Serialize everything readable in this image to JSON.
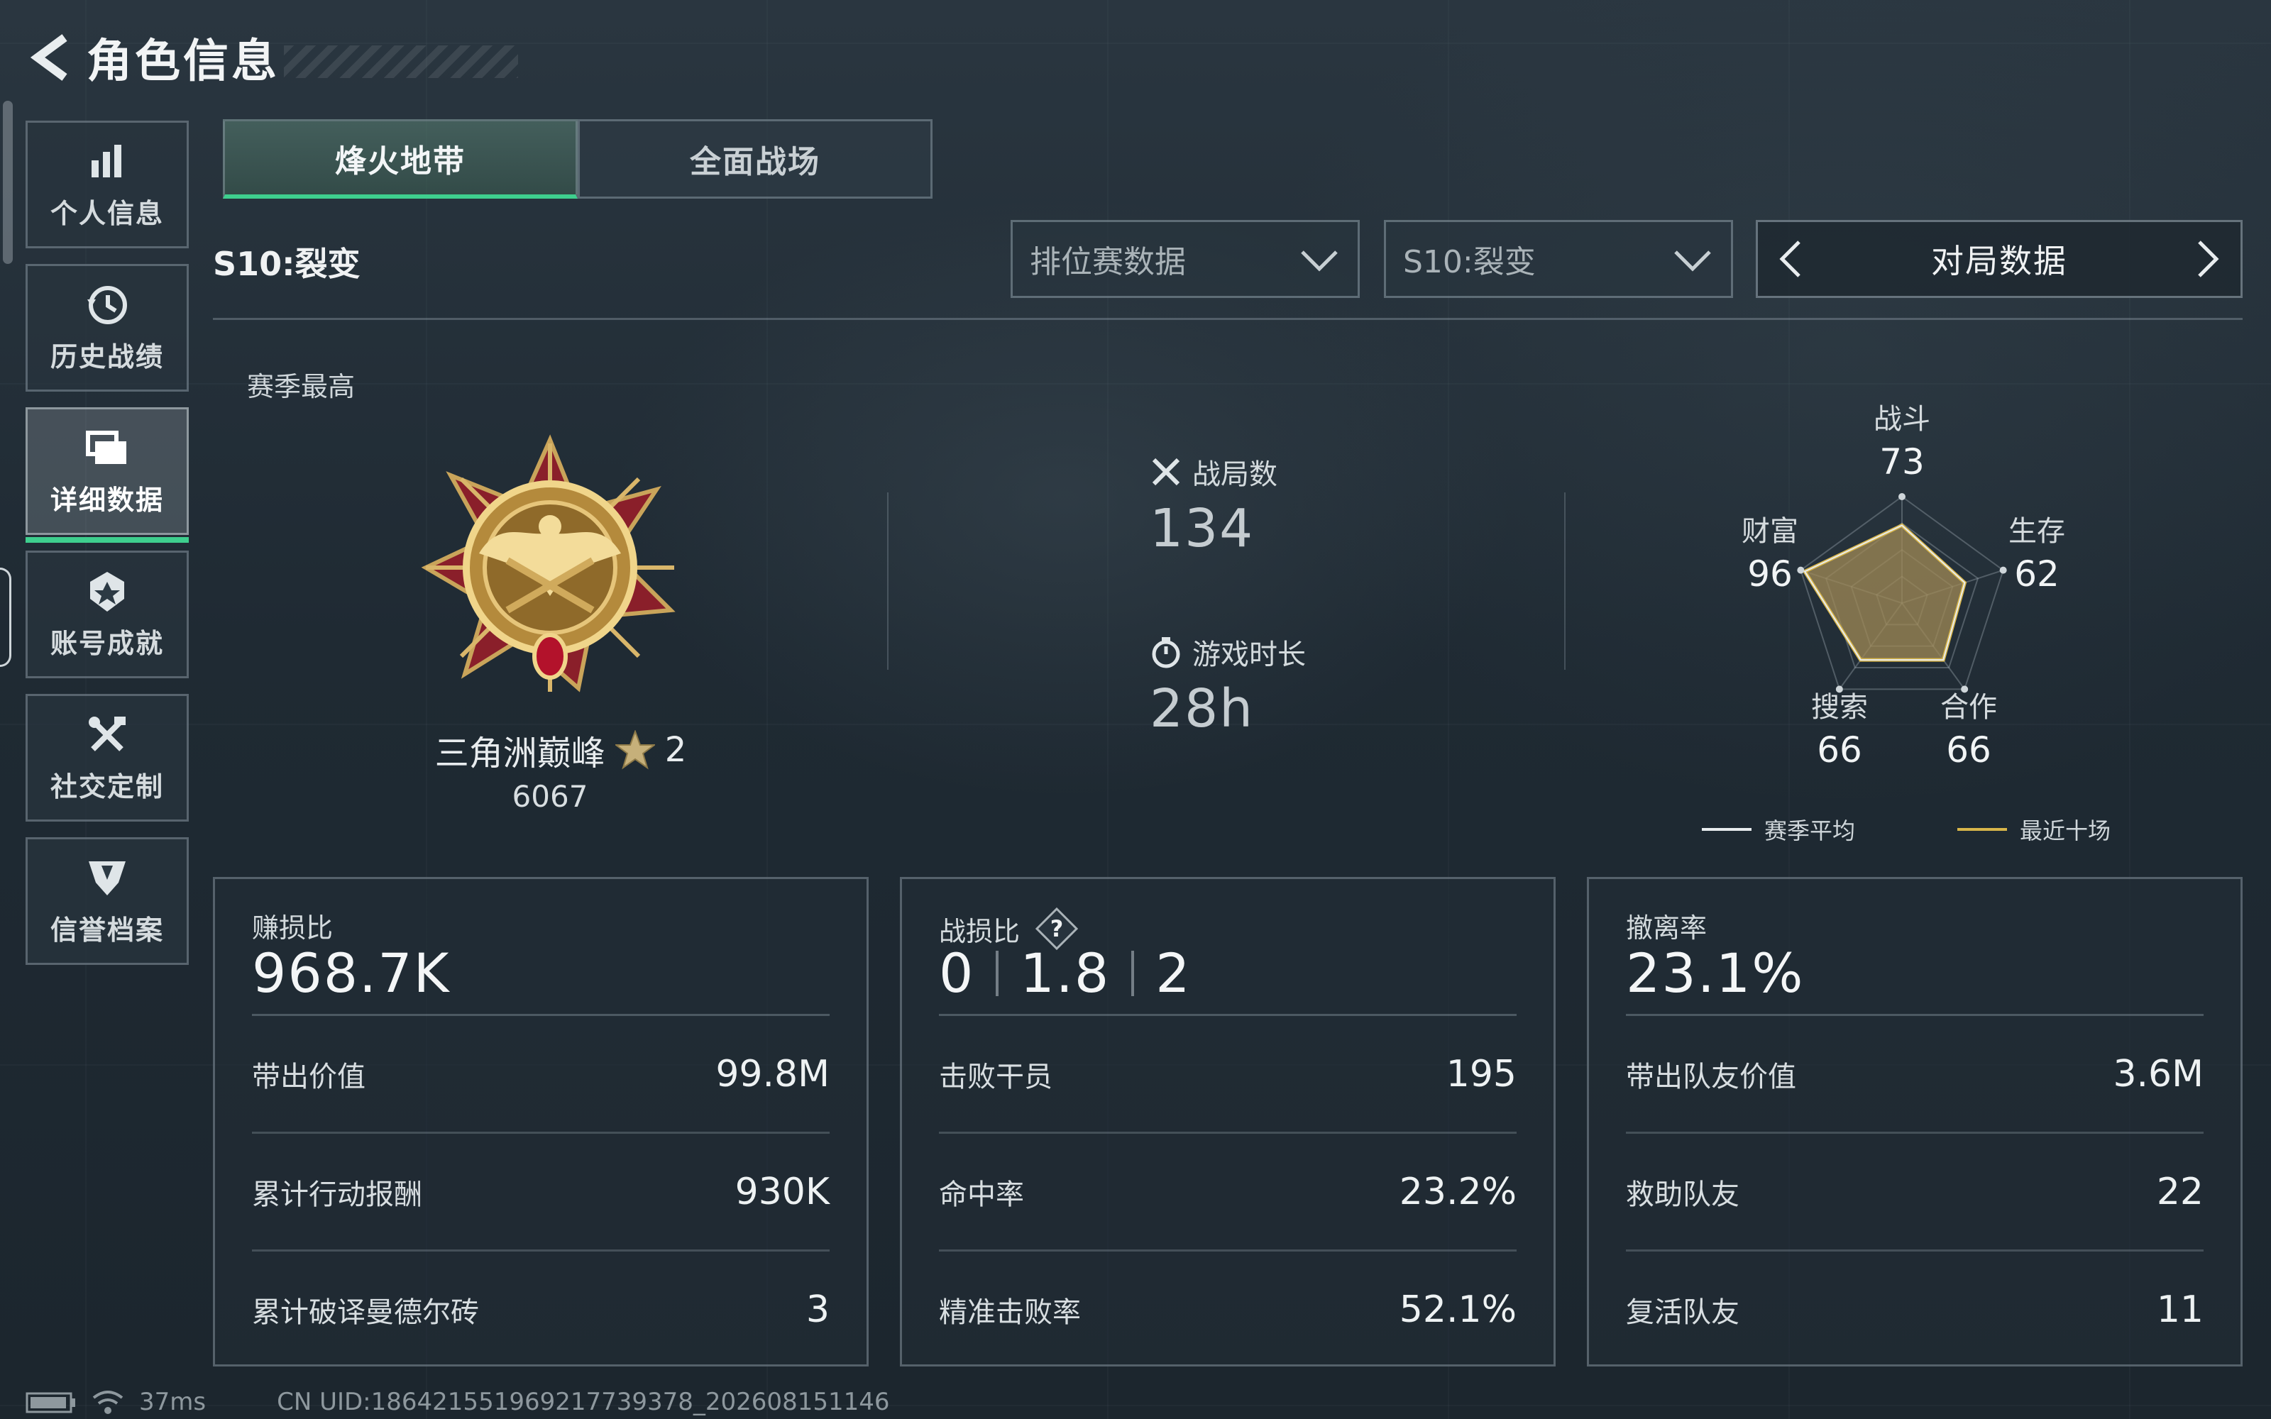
{
  "header": {
    "title": "角色信息"
  },
  "sidebar": {
    "items": [
      {
        "label": "个人信息",
        "icon": "bar-chart-icon"
      },
      {
        "label": "历史战绩",
        "icon": "history-icon"
      },
      {
        "label": "详细数据",
        "icon": "folder-icon",
        "active": true
      },
      {
        "label": "账号成就",
        "icon": "achievement-icon"
      },
      {
        "label": "社交定制",
        "icon": "tools-icon"
      },
      {
        "label": "信誉档案",
        "icon": "shield-icon"
      }
    ]
  },
  "mode_tabs": [
    {
      "label": "烽火地带",
      "active": true
    },
    {
      "label": "全面战场",
      "active": false
    }
  ],
  "filters": {
    "season_label": "S10:裂变",
    "data_type": "排位赛数据",
    "season_select": "S10:裂变",
    "view_title": "对局数据"
  },
  "season_best": {
    "label": "赛季最高",
    "rank_name": "三角洲巅峰",
    "stars": "2",
    "score": "6067"
  },
  "overview": {
    "matches_label": "战局数",
    "matches_value": "134",
    "playtime_label": "游戏时长",
    "playtime_value": "28h"
  },
  "radar": {
    "axes": [
      {
        "name": "战斗",
        "value": "73"
      },
      {
        "name": "生存",
        "value": "62"
      },
      {
        "name": "合作",
        "value": "66"
      },
      {
        "name": "搜索",
        "value": "66"
      },
      {
        "name": "财富",
        "value": "96"
      }
    ],
    "legend_avg": "赛季平均",
    "legend_recent": "最近十场",
    "colors": {
      "avg": "#e8ecee",
      "recent": "#d8b64a",
      "fill": "#a08a55"
    }
  },
  "cards": [
    {
      "title": "赚损比",
      "value": "968.7K",
      "rows": [
        {
          "label": "带出价值",
          "value": "99.8M"
        },
        {
          "label": "累计行动报酬",
          "value": "930K"
        },
        {
          "label": "累计破译曼德尔砖",
          "value": "3"
        }
      ]
    },
    {
      "title": "战损比",
      "value_parts": [
        "0",
        "1.8",
        "2"
      ],
      "rows": [
        {
          "label": "击败干员",
          "value": "195"
        },
        {
          "label": "命中率",
          "value": "23.2%"
        },
        {
          "label": "精准击败率",
          "value": "52.1%"
        }
      ]
    },
    {
      "title": "撤离率",
      "value": "23.1%",
      "rows": [
        {
          "label": "带出队友价值",
          "value": "3.6M"
        },
        {
          "label": "救助队友",
          "value": "22"
        },
        {
          "label": "复活队友",
          "value": "11"
        }
      ]
    }
  ],
  "footer": {
    "ping": "37ms",
    "uid": "CN UID:186421551969217739378_202608151146"
  },
  "accent": "#3ecf8e"
}
